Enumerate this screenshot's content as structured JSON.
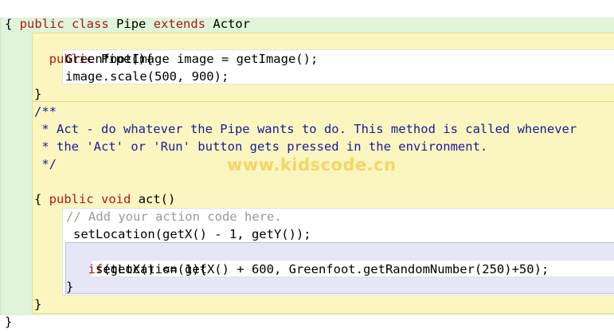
{
  "editor": {
    "watermark": "www.kidscode.cn",
    "lines": {
      "class_decl": [
        "public",
        "class",
        "Pipe",
        "extends",
        "Actor"
      ],
      "class_open": "{",
      "ctor_sig": [
        "public",
        "Pipe(){"
      ],
      "ctor_l1": "GreenfootImage image = getImage();",
      "ctor_l2": "image.scale(500, 900);",
      "ctor_close": "}",
      "doc_1": "/**",
      "doc_2": " * Act - do whatever the Pipe wants to do. This method is called whenever",
      "doc_3": " * the 'Act' or 'Run' button gets pressed in the environment.",
      "doc_4": " */",
      "act_sig": [
        "public",
        "void",
        "act()"
      ],
      "act_open": "{",
      "act_comment": "// Add your action code here.",
      "act_l1": "setLocation(getX() - 1, getY());",
      "if_kw": "if",
      "if_rest": "(getX() <= 1){",
      "if_body": "setLocation(getX() + 600, Greenfoot.getRandomNumber(250)+50);",
      "if_close": "}",
      "act_close": "}",
      "class_close": "}"
    }
  }
}
